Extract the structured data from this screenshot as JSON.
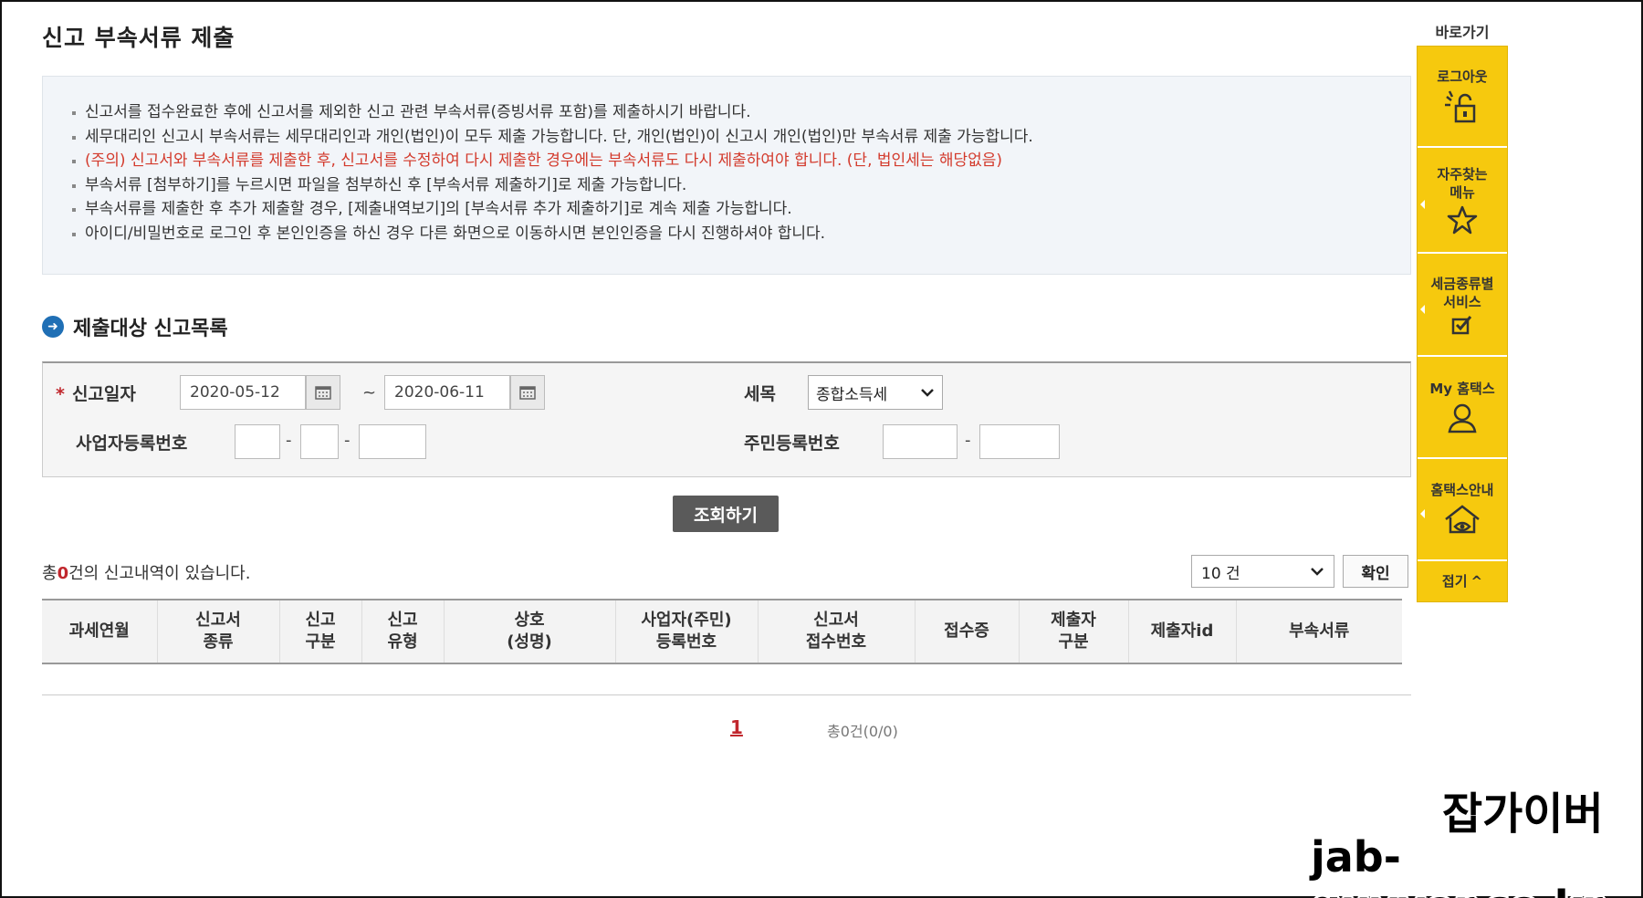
{
  "page": {
    "title": "신고 부속서류 제출"
  },
  "notice": {
    "items": [
      "신고서를 접수완료한 후에 신고서를 제외한 신고 관련 부속서류(증빙서류 포함)를 제출하시기 바랍니다.",
      "세무대리인 신고시 부속서류는 세무대리인과 개인(법인)이 모두 제출 가능합니다. 단, 개인(법인)이 신고시 개인(법인)만 부속서류 제출 가능합니다.",
      "(주의) 신고서와 부속서류를 제출한 후, 신고서를 수정하여 다시 제출한 경우에는 부속서류도 다시 제출하여야 합니다. (단, 법인세는 해당없음)",
      "부속서류 [첨부하기]를 누르시면 파일을 첨부하신 후 [부속서류 제출하기]로 제출 가능합니다.",
      "부속서류를 제출한 후 추가 제출할 경우, [제출내역보기]의 [부속서류 추가 제출하기]로 계속 제출 가능합니다.",
      "아이디/비밀번호로 로그인 후 본인인증을 하신 경우 다른 화면으로 이동하시면 본인인증을 다시 진행하셔야 합니다."
    ],
    "warn_color": "#d33a2c"
  },
  "section": {
    "title": "제출대상 신고목록",
    "icon": "arrow-circle-icon"
  },
  "search": {
    "required_mark": "*",
    "date_label": "신고일자",
    "date_from": "2020-05-12",
    "date_to": "2020-06-11",
    "tilde": "~",
    "tax_label": "세목",
    "tax_value": "종합소득세",
    "biz_label": "사업자등록번호",
    "resident_label": "주민등록번호",
    "dash": "-",
    "button": "조회하기"
  },
  "results": {
    "total_prefix": "총",
    "total_count": "0",
    "total_suffix": "건의 신고내역이 있습니다.",
    "page_size": "10 건",
    "confirm": "확인",
    "columns": [
      [
        "과세연월"
      ],
      [
        "신고서",
        "종류"
      ],
      [
        "신고",
        "구분"
      ],
      [
        "신고",
        "유형"
      ],
      [
        "상호",
        "(성명)"
      ],
      [
        "사업자(주민)",
        "등록번호"
      ],
      [
        "신고서",
        "접수번호"
      ],
      [
        "접수증"
      ],
      [
        "제출자",
        "구분"
      ],
      [
        "제출자id"
      ],
      [
        "부속서류"
      ]
    ]
  },
  "pagination": {
    "current": "1",
    "info": "총0건(0/0)"
  },
  "quick_menu": {
    "title": "바로가기",
    "items": [
      {
        "label": "로그아웃",
        "icon": "unlock-icon",
        "glyph": "🔓"
      },
      {
        "label": "자주찾는\n메뉴",
        "icon": "star-icon",
        "glyph": "☆"
      },
      {
        "label": "세금종류별\n서비스",
        "icon": "checkbox-icon",
        "glyph": "☑"
      },
      {
        "label": "My 홈택스",
        "icon": "user-icon",
        "glyph": "⚇"
      },
      {
        "label": "홈택스안내",
        "icon": "home-guide-icon",
        "glyph": "⌂"
      }
    ],
    "fold": "접기",
    "fold_arrow": "^",
    "color": "#f6c90e"
  },
  "watermark": {
    "line1": "잡가이버",
    "line2": "jab-guyver.co.kr"
  }
}
